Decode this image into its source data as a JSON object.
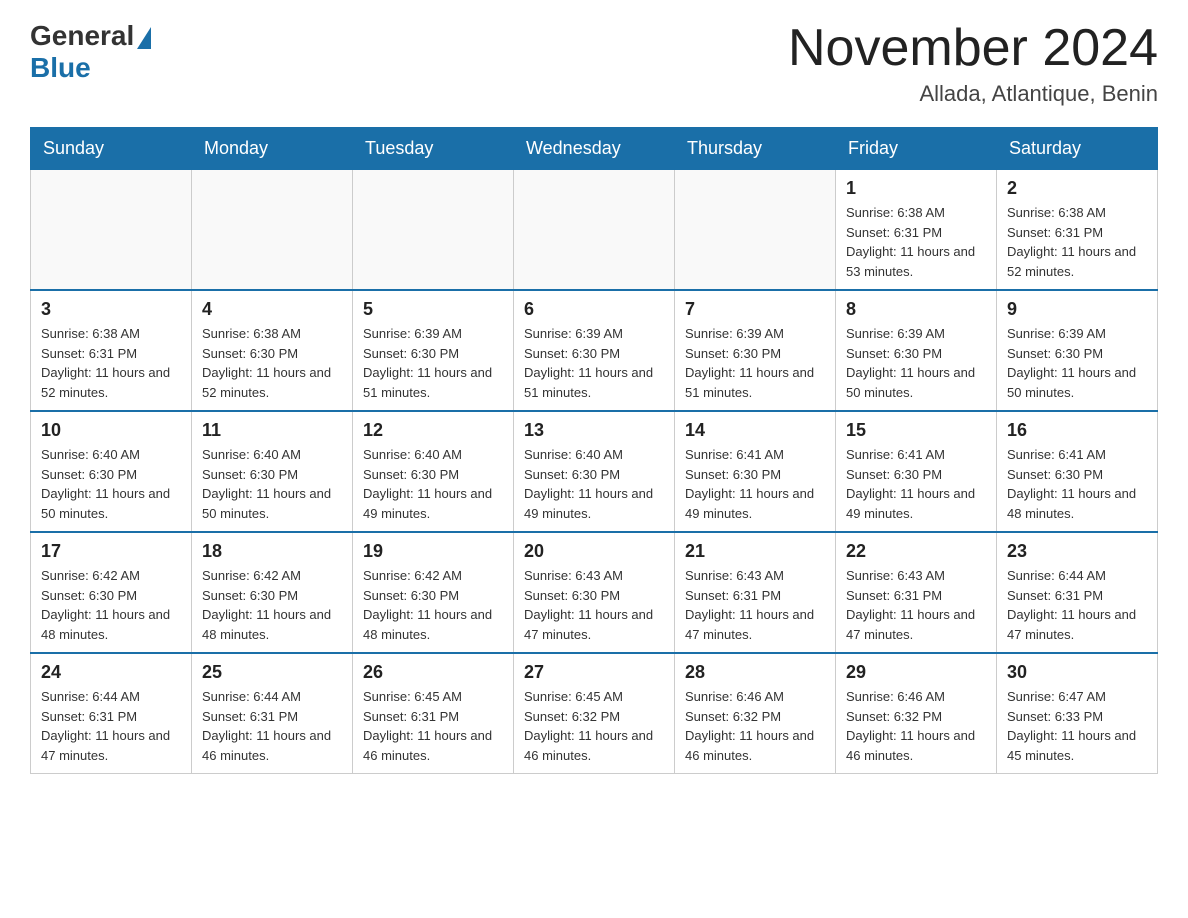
{
  "header": {
    "logo_general": "General",
    "logo_blue": "Blue",
    "title": "November 2024",
    "subtitle": "Allada, Atlantique, Benin"
  },
  "days_of_week": [
    "Sunday",
    "Monday",
    "Tuesday",
    "Wednesday",
    "Thursday",
    "Friday",
    "Saturday"
  ],
  "weeks": [
    [
      {
        "day": "",
        "info": ""
      },
      {
        "day": "",
        "info": ""
      },
      {
        "day": "",
        "info": ""
      },
      {
        "day": "",
        "info": ""
      },
      {
        "day": "",
        "info": ""
      },
      {
        "day": "1",
        "info": "Sunrise: 6:38 AM\nSunset: 6:31 PM\nDaylight: 11 hours and 53 minutes."
      },
      {
        "day": "2",
        "info": "Sunrise: 6:38 AM\nSunset: 6:31 PM\nDaylight: 11 hours and 52 minutes."
      }
    ],
    [
      {
        "day": "3",
        "info": "Sunrise: 6:38 AM\nSunset: 6:31 PM\nDaylight: 11 hours and 52 minutes."
      },
      {
        "day": "4",
        "info": "Sunrise: 6:38 AM\nSunset: 6:30 PM\nDaylight: 11 hours and 52 minutes."
      },
      {
        "day": "5",
        "info": "Sunrise: 6:39 AM\nSunset: 6:30 PM\nDaylight: 11 hours and 51 minutes."
      },
      {
        "day": "6",
        "info": "Sunrise: 6:39 AM\nSunset: 6:30 PM\nDaylight: 11 hours and 51 minutes."
      },
      {
        "day": "7",
        "info": "Sunrise: 6:39 AM\nSunset: 6:30 PM\nDaylight: 11 hours and 51 minutes."
      },
      {
        "day": "8",
        "info": "Sunrise: 6:39 AM\nSunset: 6:30 PM\nDaylight: 11 hours and 50 minutes."
      },
      {
        "day": "9",
        "info": "Sunrise: 6:39 AM\nSunset: 6:30 PM\nDaylight: 11 hours and 50 minutes."
      }
    ],
    [
      {
        "day": "10",
        "info": "Sunrise: 6:40 AM\nSunset: 6:30 PM\nDaylight: 11 hours and 50 minutes."
      },
      {
        "day": "11",
        "info": "Sunrise: 6:40 AM\nSunset: 6:30 PM\nDaylight: 11 hours and 50 minutes."
      },
      {
        "day": "12",
        "info": "Sunrise: 6:40 AM\nSunset: 6:30 PM\nDaylight: 11 hours and 49 minutes."
      },
      {
        "day": "13",
        "info": "Sunrise: 6:40 AM\nSunset: 6:30 PM\nDaylight: 11 hours and 49 minutes."
      },
      {
        "day": "14",
        "info": "Sunrise: 6:41 AM\nSunset: 6:30 PM\nDaylight: 11 hours and 49 minutes."
      },
      {
        "day": "15",
        "info": "Sunrise: 6:41 AM\nSunset: 6:30 PM\nDaylight: 11 hours and 49 minutes."
      },
      {
        "day": "16",
        "info": "Sunrise: 6:41 AM\nSunset: 6:30 PM\nDaylight: 11 hours and 48 minutes."
      }
    ],
    [
      {
        "day": "17",
        "info": "Sunrise: 6:42 AM\nSunset: 6:30 PM\nDaylight: 11 hours and 48 minutes."
      },
      {
        "day": "18",
        "info": "Sunrise: 6:42 AM\nSunset: 6:30 PM\nDaylight: 11 hours and 48 minutes."
      },
      {
        "day": "19",
        "info": "Sunrise: 6:42 AM\nSunset: 6:30 PM\nDaylight: 11 hours and 48 minutes."
      },
      {
        "day": "20",
        "info": "Sunrise: 6:43 AM\nSunset: 6:30 PM\nDaylight: 11 hours and 47 minutes."
      },
      {
        "day": "21",
        "info": "Sunrise: 6:43 AM\nSunset: 6:31 PM\nDaylight: 11 hours and 47 minutes."
      },
      {
        "day": "22",
        "info": "Sunrise: 6:43 AM\nSunset: 6:31 PM\nDaylight: 11 hours and 47 minutes."
      },
      {
        "day": "23",
        "info": "Sunrise: 6:44 AM\nSunset: 6:31 PM\nDaylight: 11 hours and 47 minutes."
      }
    ],
    [
      {
        "day": "24",
        "info": "Sunrise: 6:44 AM\nSunset: 6:31 PM\nDaylight: 11 hours and 47 minutes."
      },
      {
        "day": "25",
        "info": "Sunrise: 6:44 AM\nSunset: 6:31 PM\nDaylight: 11 hours and 46 minutes."
      },
      {
        "day": "26",
        "info": "Sunrise: 6:45 AM\nSunset: 6:31 PM\nDaylight: 11 hours and 46 minutes."
      },
      {
        "day": "27",
        "info": "Sunrise: 6:45 AM\nSunset: 6:32 PM\nDaylight: 11 hours and 46 minutes."
      },
      {
        "day": "28",
        "info": "Sunrise: 6:46 AM\nSunset: 6:32 PM\nDaylight: 11 hours and 46 minutes."
      },
      {
        "day": "29",
        "info": "Sunrise: 6:46 AM\nSunset: 6:32 PM\nDaylight: 11 hours and 46 minutes."
      },
      {
        "day": "30",
        "info": "Sunrise: 6:47 AM\nSunset: 6:33 PM\nDaylight: 11 hours and 45 minutes."
      }
    ]
  ]
}
